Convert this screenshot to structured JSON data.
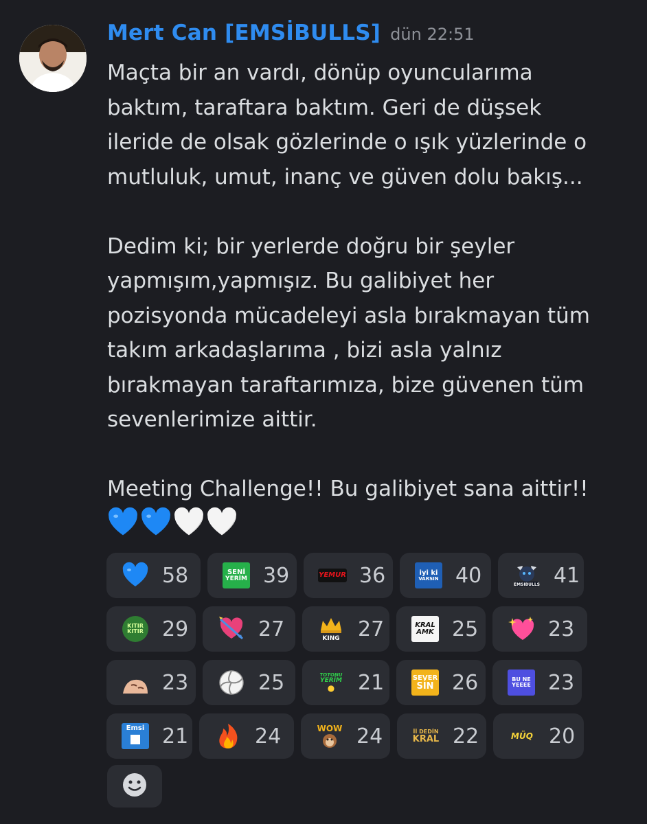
{
  "message": {
    "author": "Mert Can [EMSİBULLS]",
    "timestamp": "dün 22:51",
    "lines": [
      "Maçta bir an vardı, dönüp oyuncularıma",
      "baktım, taraftara baktım. Geri de düşsek",
      "ileride de olsak gözlerinde o ışık yüzlerinde o",
      "mutluluk, umut, inanç ve güven dolu bakış...",
      "",
      "Dedim ki; bir yerlerde doğru bir şeyler",
      "yapmışım,yapmışız. Bu galibiyet her",
      "pozisyonda mücadeleyi asla bırakmayan  tüm",
      "takım arkadaşlarıma , bizi asla yalnız",
      "bırakmayan taraftarımıza, bize güvenen tüm",
      "sevenlerimize aittir.",
      "",
      "Meeting Challenge!! Bu galibiyet sana aittir!!"
    ],
    "trailing_emojis": [
      "blue-heart",
      "blue-heart",
      "white-heart",
      "white-heart"
    ]
  },
  "colors": {
    "background": "#1c1d22",
    "author": "#2f8cf0",
    "timestamp": "#8d9097",
    "text": "#dbdee1",
    "reaction_bg": "#2b2d33"
  },
  "reactions": [
    {
      "icon": "blue-heart",
      "count": "58"
    },
    {
      "icon": "seni-yerim-sticker",
      "label": [
        "SENİ",
        "YERİM"
      ],
      "count": "39"
    },
    {
      "icon": "yemur-sticker",
      "label": [
        "YEMUR"
      ],
      "count": "36"
    },
    {
      "icon": "iyi-ki-varsin-sticker",
      "label": [
        "iyi ki",
        "VARSIN"
      ],
      "count": "40"
    },
    {
      "icon": "emsibulls-logo",
      "label": [
        "EMSIBULLS"
      ],
      "count": "41"
    },
    {
      "icon": "kitir-kitir-sticker",
      "label": [
        "KITIR",
        "KITIR"
      ],
      "count": "29"
    },
    {
      "icon": "heart-with-arrow",
      "count": "27"
    },
    {
      "icon": "king-crown-sticker",
      "label": [
        "KING"
      ],
      "count": "27"
    },
    {
      "icon": "kral-amk-sticker",
      "label": [
        "KRAL",
        "AMK"
      ],
      "count": "25"
    },
    {
      "icon": "sparkling-heart",
      "count": "23"
    },
    {
      "icon": "face-peek-sticker",
      "count": "23"
    },
    {
      "icon": "volleyball",
      "count": "25"
    },
    {
      "icon": "totonu-yerim-sticker",
      "label": [
        "TOTONU",
        "YERİM"
      ],
      "count": "21"
    },
    {
      "icon": "seversin-sticker",
      "label": [
        "SEVER",
        "SİN"
      ],
      "count": "26"
    },
    {
      "icon": "bu-ne-yeeee-sticker",
      "label": [
        "BU NE",
        "YEEEE"
      ],
      "count": "23"
    },
    {
      "icon": "emsi-card-sticker",
      "label": [
        "Emsi"
      ],
      "count": "21"
    },
    {
      "icon": "fire",
      "count": "24"
    },
    {
      "icon": "wow-monkey-sticker",
      "label": [
        "WOW"
      ],
      "count": "24"
    },
    {
      "icon": "ii-dedin-kral-sticker",
      "label": [
        "İİ DEDİN",
        "KRAL"
      ],
      "count": "22"
    },
    {
      "icon": "muq-sticker",
      "label": [
        "MÜQ"
      ],
      "count": "20"
    }
  ]
}
